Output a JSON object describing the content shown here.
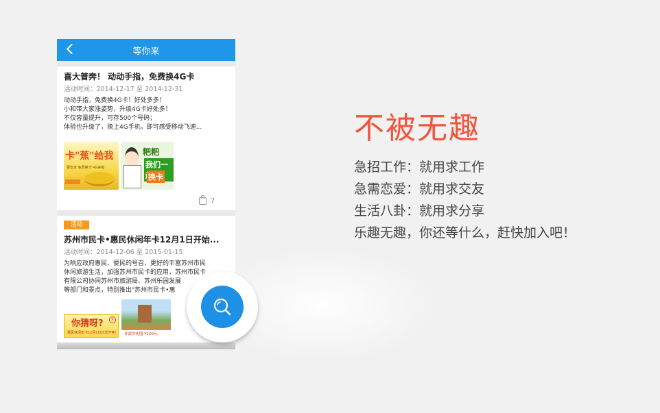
{
  "app": {
    "title": "等你来"
  },
  "feed": {
    "card1": {
      "title": "喜大普奔！ 动动手指，免费换4G卡",
      "date": "活动时间：2014-12-17 至 2014-12-31",
      "body": [
        "动动手指，免费换4G卡！好处多多！",
        " 小和带大家涨姿势，升级4G卡好处多！",
        "不仅容量提升，可存500个号码；",
        "体验也升级了，换上4G手机，即可感受移动飞速..."
      ],
      "image1_text": "卡\"蕉\"给我",
      "image1_sub": "更安全 免费换卡 4G来啦",
      "image2_text1": "粑粑",
      "image2_text2": "我们一起",
      "image2_text3": "换卡",
      "likes": "7"
    },
    "card2": {
      "badge": "活动",
      "title": "苏州市民卡•惠民休闲年卡12月1日开始...",
      "date": "活动时间：2014-12-06 至 2015-01-15",
      "body": [
        "为响应政府惠民、便民的号召，更好的丰富苏州市民",
        "休闲旅游生活，加强苏州市民卡的应用，苏州市民卡",
        "有限公司协同苏州市旅游局、苏州乐园发展",
        "等部门和景点，特别推出\"苏州市民卡•惠"
      ],
      "image1_text": "你猜呀?",
      "image1_sub": "惠民休闲年卡12月1日正式开卖!",
      "image2_text": "孙武文化园  ¥100元"
    }
  },
  "fab": {
    "icon": "search-icon",
    "color": "#1e90e6"
  },
  "promo": {
    "title": "不被无趣",
    "title_color": "#f0553c",
    "lines": [
      "急招工作：就用求工作",
      "急需恋爱：就用求交友",
      "生活八卦：就用求分享",
      "乐趣无趣，你还等什么，赶快加入吧！"
    ]
  }
}
